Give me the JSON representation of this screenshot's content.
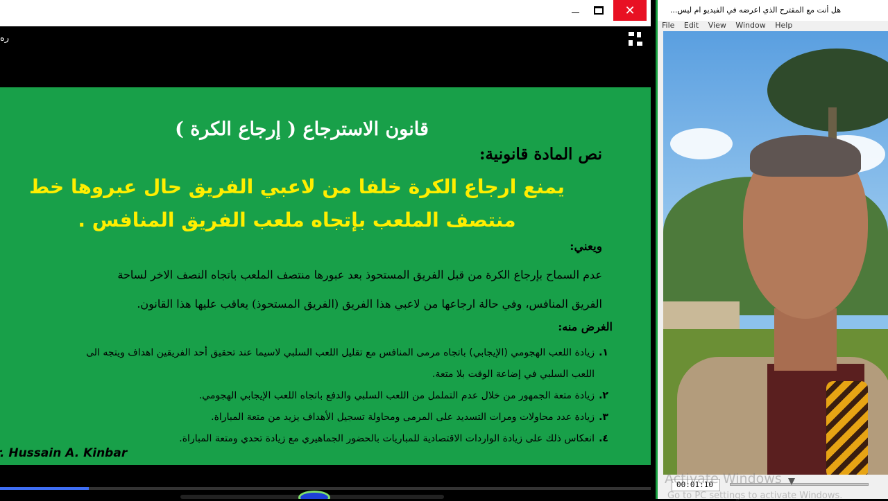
{
  "left_window": {
    "top_corner_text": "ره",
    "controls": {
      "minimize": "—",
      "maximize": "☐",
      "close": "✕"
    }
  },
  "slide": {
    "title": "قانون الاسترجاع ( إرجاع الكرة )",
    "subhead": "نص المادة قانونية:",
    "law_text": "يمنع ارجاع الكرة خلفا من لاعبي الفريق حال عبروها خط منتصف الملعب بإتجاه ملعب الفريق المنافس .",
    "means_heading": "ويعني:",
    "means_lines": [
      "عدم السماح بإرجاع الكرة من قبل الفريق المستحوذ بعد عبورها منتصف الملعب باتجاه النصف الاخر لساحة",
      "الفريق المنافس، وفي حالة ارجاعها من لاعبي هذا الفريق (الفريق المستحوذ) يعاقب عليها هذا القانون."
    ],
    "purpose_heading": "الغرض منه:",
    "purpose_items": [
      {
        "num": "١.",
        "text": "زيادة اللعب الهجومي (الإيجابي) باتجاه مرمى المنافس مع تقليل اللعب السلبي لاسيما عند تحقيق أحد الفريقين اهداف ويتجه الى"
      },
      {
        "num": "",
        "text": "اللعب السلبي في إضاعة الوقت بلا متعة."
      },
      {
        "num": "٢.",
        "text": "زيادة متعة الجمهور من خلال عدم التململ من اللعب السلبي والدفع باتجاه اللعب الإيجابي الهجومي."
      },
      {
        "num": "٣.",
        "text": "زيادة عدد محاولات ومرات التسديد على المرمى ومحاولة تسجيل الأهداف يزيد من متعة المباراة."
      },
      {
        "num": "٤.",
        "text": "انعكاس ذلك على زيادة الواردات الاقتصادية للمباريات بالحضور الجماهيري مع زيادة تحدي ومتعة المباراة."
      }
    ],
    "author": "r. Hussain A. Kinbar"
  },
  "playback": {
    "progress_fraction": 0.136
  },
  "right_window": {
    "title": "هل أنت مع المقترح  الذي اعرضه في الفيديو ام ليس...",
    "menu": [
      "File",
      "Edit",
      "View",
      "Window",
      "Help"
    ],
    "time": "00:01:10",
    "watermark_line1": "Activate Windows",
    "watermark_line2": "Go to PC settings to activate Windows."
  },
  "colors": {
    "slide_bg": "#18a049",
    "law_text": "#ffee00",
    "close_btn": "#e81123",
    "progress": "#3f6ff5"
  }
}
